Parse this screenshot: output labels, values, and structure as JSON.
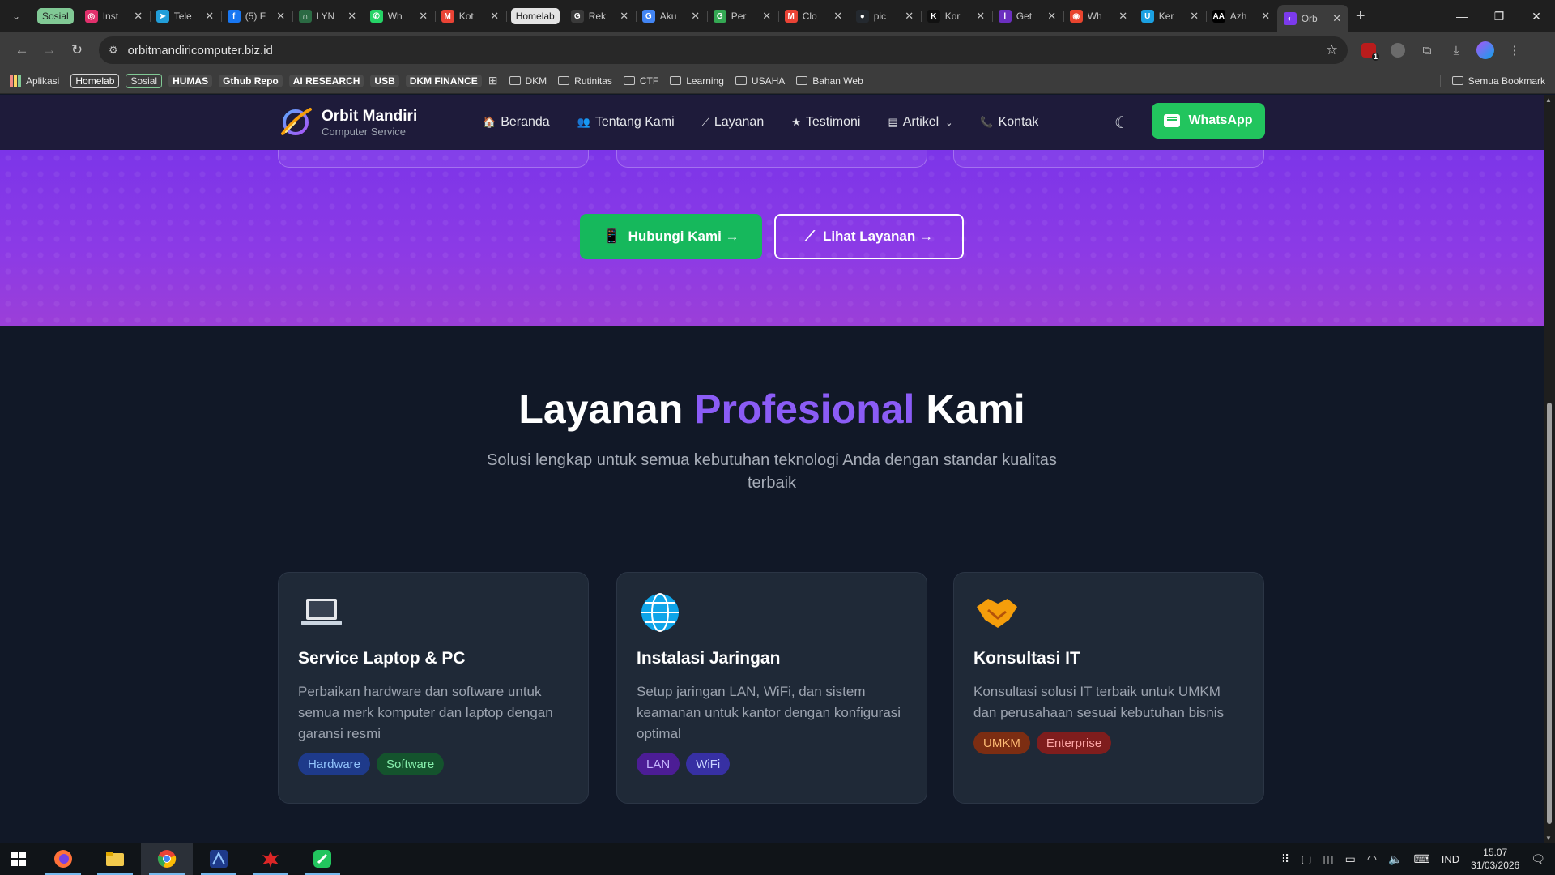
{
  "browser": {
    "tab_search_label": "⌄",
    "tabs": [
      {
        "type": "group",
        "label": "Sosial",
        "color": "#81c995",
        "text": "#1f1f1f"
      },
      {
        "type": "tab",
        "title": "Inst",
        "fav_bg": "#e1306c",
        "fav_txt": "◎"
      },
      {
        "type": "tab",
        "title": "Tele",
        "fav_bg": "#229ed9",
        "fav_txt": "➤"
      },
      {
        "type": "tab",
        "title": "(5) F",
        "fav_bg": "#1877f2",
        "fav_txt": "f"
      },
      {
        "type": "tab",
        "title": "LYN",
        "fav_bg": "#2b6a43",
        "fav_txt": "∩"
      },
      {
        "type": "tab",
        "title": "Wh",
        "fav_bg": "#25d366",
        "fav_txt": "✆"
      },
      {
        "type": "tab",
        "title": "Kot",
        "fav_bg": "#ea4335",
        "fav_txt": "M"
      },
      {
        "type": "group",
        "label": "Homelab",
        "color": "#e3e3e3",
        "text": "#1f1f1f"
      },
      {
        "type": "tab",
        "title": "Rek",
        "fav_bg": "#3a3a3a",
        "fav_txt": "G"
      },
      {
        "type": "tab",
        "title": "Aku",
        "fav_bg": "#4285f4",
        "fav_txt": "G"
      },
      {
        "type": "tab",
        "title": "Per",
        "fav_bg": "#34a853",
        "fav_txt": "G"
      },
      {
        "type": "tab",
        "title": "Clo",
        "fav_bg": "#ea4335",
        "fav_txt": "M"
      },
      {
        "type": "tab",
        "title": "pic",
        "fav_bg": "#24292f",
        "fav_txt": "●"
      },
      {
        "type": "tab",
        "title": "Kor",
        "fav_bg": "#111111",
        "fav_txt": "K"
      },
      {
        "type": "tab",
        "title": "Get",
        "fav_bg": "#6b2fbf",
        "fav_txt": "l"
      },
      {
        "type": "tab",
        "title": "Wh",
        "fav_bg": "#e8442e",
        "fav_txt": "◉"
      },
      {
        "type": "tab",
        "title": "Ker",
        "fav_bg": "#1ba0e1",
        "fav_txt": "U"
      },
      {
        "type": "tab",
        "title": "Azh",
        "fav_bg": "#000000",
        "fav_txt": "AA"
      },
      {
        "type": "tab",
        "title": "Orb",
        "fav_bg": "#7c3aed",
        "fav_txt": "◐",
        "active": true
      }
    ],
    "new_tab": "+",
    "win_min": "—",
    "win_max": "❐",
    "win_close": "✕",
    "url": "orbitmandiricomputer.biz.id",
    "bookmarks_left": [
      {
        "label": "Aplikasi",
        "kind": "apps"
      },
      {
        "label": "Homelab",
        "kind": "chip-outline"
      },
      {
        "label": "Sosial",
        "kind": "chip-green"
      },
      {
        "label": "HUMAS",
        "kind": "chip"
      },
      {
        "label": "Gthub Repo",
        "kind": "chip"
      },
      {
        "label": "AI RESEARCH",
        "kind": "chip"
      },
      {
        "label": "USB",
        "kind": "chip"
      },
      {
        "label": "DKM FINANCE",
        "kind": "chip"
      },
      {
        "label": "",
        "kind": "grid"
      },
      {
        "label": "DKM",
        "kind": "folder"
      },
      {
        "label": "Rutinitas",
        "kind": "folder"
      },
      {
        "label": "CTF",
        "kind": "folder"
      },
      {
        "label": "Learning",
        "kind": "folder"
      },
      {
        "label": "USAHA",
        "kind": "folder"
      },
      {
        "label": "Bahan Web",
        "kind": "folder"
      }
    ],
    "bookmarks_right": "Semua Bookmark",
    "ext_badge": "1"
  },
  "site": {
    "brand_name": "Orbit Mandiri",
    "brand_sub": "Computer Service",
    "nav": [
      {
        "label": "Beranda",
        "icon": "🏠"
      },
      {
        "label": "Tentang Kami",
        "icon": "👥"
      },
      {
        "label": "Layanan",
        "icon": "⟋"
      },
      {
        "label": "Testimoni",
        "icon": "★"
      },
      {
        "label": "Artikel",
        "icon": "▤",
        "dropdown": true
      },
      {
        "label": "Kontak",
        "icon": "📞"
      }
    ],
    "theme_icon": "☾",
    "whatsapp_label": "WhatsApp",
    "hero": {
      "primary_btn": "Hubungi Kami →",
      "primary_icon": "📱",
      "outline_btn": "Lihat Layanan →",
      "outline_icon": "⟋"
    },
    "services": {
      "title_a": "Layanan ",
      "title_hl": "Profesional",
      "title_b": " Kami",
      "subtitle": "Solusi lengkap untuk semua kebutuhan teknologi Anda dengan standar kualitas terbaik",
      "cards": [
        {
          "icon": "laptop",
          "title": "Service Laptop & PC",
          "desc": "Perbaikan hardware dan software untuk semua merk komputer dan laptop dengan garansi resmi",
          "tags": [
            {
              "label": "Hardware",
              "bg": "#1e3a8a",
              "fg": "#93c5fd"
            },
            {
              "label": "Software",
              "bg": "#14532d",
              "fg": "#86efac"
            }
          ]
        },
        {
          "icon": "globe",
          "title": "Instalasi Jaringan",
          "desc": "Setup jaringan LAN, WiFi, dan sistem keamanan untuk kantor dengan konfigurasi optimal",
          "tags": [
            {
              "label": "LAN",
              "bg": "#4c1d95",
              "fg": "#c4b5fd"
            },
            {
              "label": "WiFi",
              "bg": "#3730a3",
              "fg": "#c7d2fe"
            }
          ]
        },
        {
          "icon": "handshake",
          "title": "Konsultasi IT",
          "desc": "Konsultasi solusi IT terbaik untuk UMKM dan perusahaan sesuai kebutuhan bisnis",
          "tags": [
            {
              "label": "UMKM",
              "bg": "#7c2d12",
              "fg": "#fdba74"
            },
            {
              "label": "Enterprise",
              "bg": "#7f1d1d",
              "fg": "#fca5a5"
            }
          ]
        }
      ]
    }
  },
  "taskbar": {
    "apps": [
      "windows-start",
      "firefox",
      "file-explorer",
      "chrome",
      "app-blue",
      "app-red",
      "app-green"
    ],
    "lang": "IND",
    "time": "15.07",
    "date": "31/03/2026"
  }
}
